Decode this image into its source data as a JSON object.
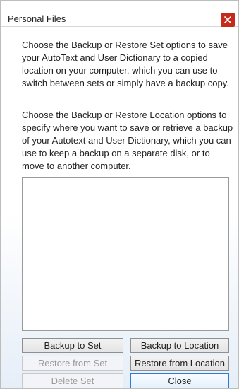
{
  "window": {
    "title": "Personal Files",
    "close_icon": "close-icon"
  },
  "content": {
    "paragraph1": "Choose the Backup or Restore Set options to save your AutoText and User Dictionary to a copied location on your computer, which you can use to switch between sets or simply have a backup copy.",
    "paragraph2": "Choose the Backup or Restore Location options to specify where you want to save or retrieve a backup of your Autotext and User Dictionary, which you can use to keep a backup on a separate disk, or to move to another computer."
  },
  "list": {
    "items": []
  },
  "buttons": {
    "backup_to_set": "Backup to Set",
    "backup_to_location": "Backup to Location",
    "restore_from_set": "Restore from Set",
    "restore_from_location": "Restore from Location",
    "delete_set": "Delete Set",
    "close": "Close"
  },
  "colors": {
    "close_button": "#c42b1c",
    "default_button_border": "#2d7bd6",
    "disabled_text": "#9b9b9b"
  }
}
